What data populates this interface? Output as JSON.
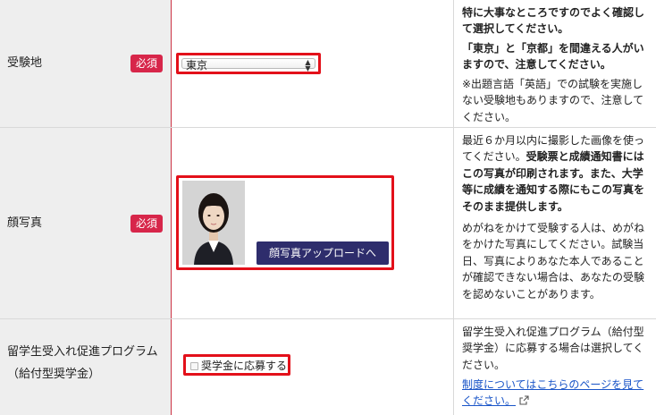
{
  "rows": [
    {
      "label": "受験地",
      "required_badge": "必須",
      "select_value": "東京",
      "notes": {
        "p1": "特に大事なところですのでよく確認して選択してください。",
        "p2": "「東京」と「京都」を間違える人がいますので、注意してください。",
        "p3": "※出題言語「英語」での試験を実施しない受験地もありますので、注意してください。"
      }
    },
    {
      "label": "顔写真",
      "required_badge": "必須",
      "upload_button": "顔写真アップロードへ",
      "notes": {
        "p1_normal": "最近６か月以内に撮影した画像を使ってください。",
        "p1_bold": "受験票と成績通知書にはこの写真が印刷されます。また、大学等に成績を通知する際にもこの写真をそのまま提供します。",
        "p2": "めがねをかけて受験する人は、めがねをかけた写真にしてください。試験当日、写真によりあなた本人であることが確認できない場合は、あなたの受験を認めないことがあります。"
      }
    },
    {
      "label_line1": "留学生受入れ促進プログラム",
      "label_line2": "（給付型奨学金）",
      "checkbox_label": "奨学金に応募する",
      "notes": {
        "p1": "留学生受入れ促進プログラム（給付型奨学金）に応募する場合は選択してください。",
        "link": "制度についてはこちらのページを見てください。"
      }
    }
  ],
  "colors": {
    "required": "#d7264a",
    "highlight": "#e3101a",
    "button": "#2e2d6c",
    "link": "#1a55c8",
    "label_bg": "#eeeeee"
  },
  "icons": {
    "select": "up-down-arrows",
    "link": "external-link-icon"
  }
}
